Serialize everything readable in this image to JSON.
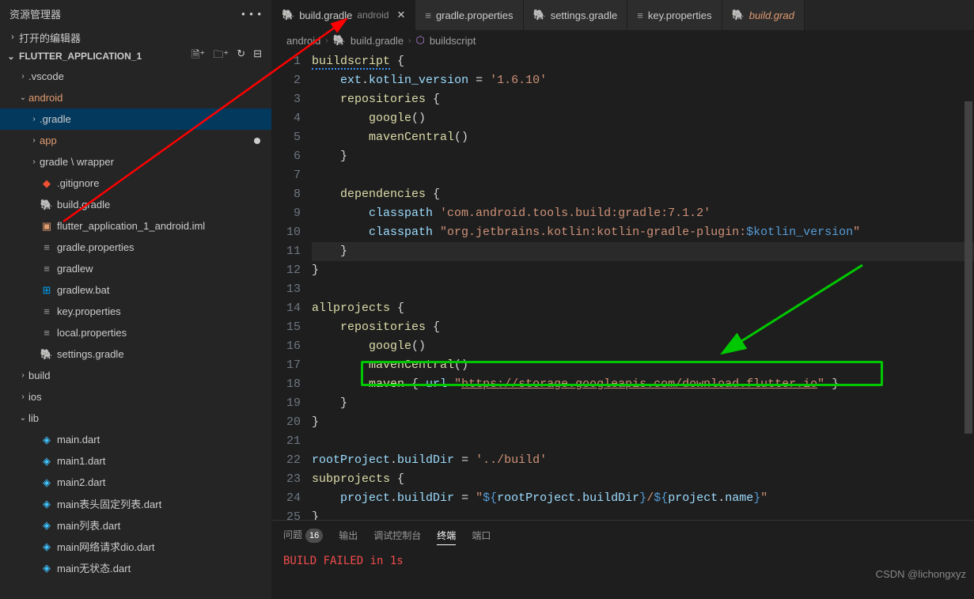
{
  "sidebar": {
    "title": "资源管理器",
    "open_editors": "打开的编辑器",
    "project_name": "FLUTTER_APPLICATION_1",
    "tree": [
      {
        "type": "folder",
        "label": ".vscode",
        "depth": 1,
        "chev": "›",
        "cls": ""
      },
      {
        "type": "folder",
        "label": "android",
        "depth": 1,
        "chev": "⌄",
        "cls": "android-folder"
      },
      {
        "type": "folder",
        "label": ".gradle",
        "depth": 2,
        "chev": "›",
        "cls": "selected"
      },
      {
        "type": "folder",
        "label": "app",
        "depth": 2,
        "chev": "›",
        "cls": "app-folder",
        "mod": true
      },
      {
        "type": "folder",
        "label": "gradle \\ wrapper",
        "depth": 2,
        "chev": "›",
        "cls": ""
      },
      {
        "type": "file",
        "label": ".gitignore",
        "depth": 2,
        "icon": "git"
      },
      {
        "type": "file",
        "label": "build.gradle",
        "depth": 2,
        "icon": "elephant"
      },
      {
        "type": "file",
        "label": "flutter_application_1_android.iml",
        "depth": 2,
        "icon": "orange"
      },
      {
        "type": "file",
        "label": "gradle.properties",
        "depth": 2,
        "icon": "lines"
      },
      {
        "type": "file",
        "label": "gradlew",
        "depth": 2,
        "icon": "lines"
      },
      {
        "type": "file",
        "label": "gradlew.bat",
        "depth": 2,
        "icon": "win"
      },
      {
        "type": "file",
        "label": "key.properties",
        "depth": 2,
        "icon": "lines"
      },
      {
        "type": "file",
        "label": "local.properties",
        "depth": 2,
        "icon": "lines"
      },
      {
        "type": "file",
        "label": "settings.gradle",
        "depth": 2,
        "icon": "elephant"
      },
      {
        "type": "folder",
        "label": "build",
        "depth": 1,
        "chev": "›",
        "cls": ""
      },
      {
        "type": "folder",
        "label": "ios",
        "depth": 1,
        "chev": "›",
        "cls": ""
      },
      {
        "type": "folder",
        "label": "lib",
        "depth": 1,
        "chev": "⌄",
        "cls": ""
      },
      {
        "type": "file",
        "label": "main.dart",
        "depth": 2,
        "icon": "dart"
      },
      {
        "type": "file",
        "label": "main1.dart",
        "depth": 2,
        "icon": "dart"
      },
      {
        "type": "file",
        "label": "main2.dart",
        "depth": 2,
        "icon": "dart"
      },
      {
        "type": "file",
        "label": "main表头固定列表.dart",
        "depth": 2,
        "icon": "dart"
      },
      {
        "type": "file",
        "label": "main列表.dart",
        "depth": 2,
        "icon": "dart"
      },
      {
        "type": "file",
        "label": "main网络请求dio.dart",
        "depth": 2,
        "icon": "dart"
      },
      {
        "type": "file",
        "label": "main无状态.dart",
        "depth": 2,
        "icon": "dart"
      }
    ]
  },
  "tabs": [
    {
      "label": "build.gradle",
      "suffix": "android",
      "icon": "elephant",
      "active": true,
      "close": true
    },
    {
      "label": "gradle.properties",
      "icon": "lines"
    },
    {
      "label": "settings.gradle",
      "icon": "elephant"
    },
    {
      "label": "key.properties",
      "icon": "lines"
    },
    {
      "label": "build.grad",
      "icon": "elephant-orange",
      "truncated": true
    }
  ],
  "breadcrumb": [
    "android",
    "build.gradle",
    "buildscript"
  ],
  "code": {
    "lines": [
      {
        "n": 1,
        "tokens": [
          [
            "fn squiggle",
            "buildscript"
          ],
          [
            "punc",
            " {"
          ]
        ]
      },
      {
        "n": 2,
        "tokens": [
          [
            "punc",
            "    "
          ],
          [
            "prop",
            "ext"
          ],
          [
            "punc",
            "."
          ],
          [
            "prop",
            "kotlin_version"
          ],
          [
            "op",
            " = "
          ],
          [
            "str",
            "'1.6.10'"
          ]
        ]
      },
      {
        "n": 3,
        "tokens": [
          [
            "punc",
            "    "
          ],
          [
            "fn",
            "repositories"
          ],
          [
            "punc",
            " {"
          ]
        ]
      },
      {
        "n": 4,
        "tokens": [
          [
            "punc",
            "        "
          ],
          [
            "fn",
            "google"
          ],
          [
            "punc",
            "()"
          ]
        ]
      },
      {
        "n": 5,
        "tokens": [
          [
            "punc",
            "        "
          ],
          [
            "fn",
            "mavenCentral"
          ],
          [
            "punc",
            "()"
          ]
        ]
      },
      {
        "n": 6,
        "tokens": [
          [
            "punc",
            "    }"
          ]
        ]
      },
      {
        "n": 7,
        "tokens": [
          [
            "punc",
            ""
          ]
        ]
      },
      {
        "n": 8,
        "tokens": [
          [
            "punc",
            "    "
          ],
          [
            "fn",
            "dependencies"
          ],
          [
            "punc",
            " {"
          ]
        ]
      },
      {
        "n": 9,
        "tokens": [
          [
            "punc",
            "        "
          ],
          [
            "prop",
            "classpath"
          ],
          [
            "punc",
            " "
          ],
          [
            "str",
            "'com.android.tools.build:gradle:7.1.2'"
          ]
        ]
      },
      {
        "n": 10,
        "tokens": [
          [
            "punc",
            "        "
          ],
          [
            "prop",
            "classpath"
          ],
          [
            "punc",
            " "
          ],
          [
            "str",
            "\"org.jetbrains.kotlin:kotlin-gradle-plugin:"
          ],
          [
            "interp",
            "$kotlin_version"
          ],
          [
            "str",
            "\""
          ]
        ]
      },
      {
        "n": 11,
        "tokens": [
          [
            "punc",
            "    }"
          ]
        ],
        "hl": true
      },
      {
        "n": 12,
        "tokens": [
          [
            "punc",
            "}"
          ]
        ]
      },
      {
        "n": 13,
        "tokens": [
          [
            "punc",
            ""
          ]
        ]
      },
      {
        "n": 14,
        "tokens": [
          [
            "fn",
            "allprojects"
          ],
          [
            "punc",
            " {"
          ]
        ]
      },
      {
        "n": 15,
        "tokens": [
          [
            "punc",
            "    "
          ],
          [
            "fn",
            "repositories"
          ],
          [
            "punc",
            " {"
          ]
        ]
      },
      {
        "n": 16,
        "tokens": [
          [
            "punc",
            "        "
          ],
          [
            "fn",
            "google"
          ],
          [
            "punc",
            "()"
          ]
        ]
      },
      {
        "n": 17,
        "tokens": [
          [
            "punc",
            "        "
          ],
          [
            "fn",
            "mavenCentral"
          ],
          [
            "punc",
            "()"
          ]
        ]
      },
      {
        "n": 18,
        "tokens": [
          [
            "punc",
            "        "
          ],
          [
            "fn",
            "maven"
          ],
          [
            "punc",
            " { "
          ],
          [
            "prop",
            "url"
          ],
          [
            "punc",
            " "
          ],
          [
            "str",
            "\""
          ],
          [
            "url-str",
            "https://storage.googleapis.com/download.flutter.io"
          ],
          [
            "str",
            "\""
          ],
          [
            "punc",
            " }"
          ]
        ]
      },
      {
        "n": 19,
        "tokens": [
          [
            "punc",
            "    }"
          ]
        ]
      },
      {
        "n": 20,
        "tokens": [
          [
            "punc",
            "}"
          ]
        ]
      },
      {
        "n": 21,
        "tokens": [
          [
            "punc",
            ""
          ]
        ]
      },
      {
        "n": 22,
        "tokens": [
          [
            "prop",
            "rootProject"
          ],
          [
            "punc",
            "."
          ],
          [
            "prop",
            "buildDir"
          ],
          [
            "op",
            " = "
          ],
          [
            "str",
            "'../build'"
          ]
        ]
      },
      {
        "n": 23,
        "tokens": [
          [
            "fn",
            "subprojects"
          ],
          [
            "punc",
            " {"
          ]
        ]
      },
      {
        "n": 24,
        "tokens": [
          [
            "punc",
            "    "
          ],
          [
            "prop",
            "project"
          ],
          [
            "punc",
            "."
          ],
          [
            "prop",
            "buildDir"
          ],
          [
            "op",
            " = "
          ],
          [
            "str",
            "\""
          ],
          [
            "interp",
            "${"
          ],
          [
            "prop",
            "rootProject"
          ],
          [
            "punc",
            "."
          ],
          [
            "prop",
            "buildDir"
          ],
          [
            "interp",
            "}"
          ],
          [
            "str",
            "/"
          ],
          [
            "interp",
            "${"
          ],
          [
            "prop",
            "project"
          ],
          [
            "punc",
            "."
          ],
          [
            "prop",
            "name"
          ],
          [
            "interp",
            "}"
          ],
          [
            "str",
            "\""
          ]
        ]
      },
      {
        "n": 25,
        "tokens": [
          [
            "punc",
            "}"
          ]
        ]
      }
    ]
  },
  "panel": {
    "tabs": [
      {
        "label": "问题",
        "badge": "16"
      },
      {
        "label": "输出"
      },
      {
        "label": "调试控制台"
      },
      {
        "label": "终端",
        "active": true
      },
      {
        "label": "端口"
      }
    ],
    "output_line1": "BUILD FAILED in 1s"
  },
  "watermark": "CSDN @lichongxyz"
}
